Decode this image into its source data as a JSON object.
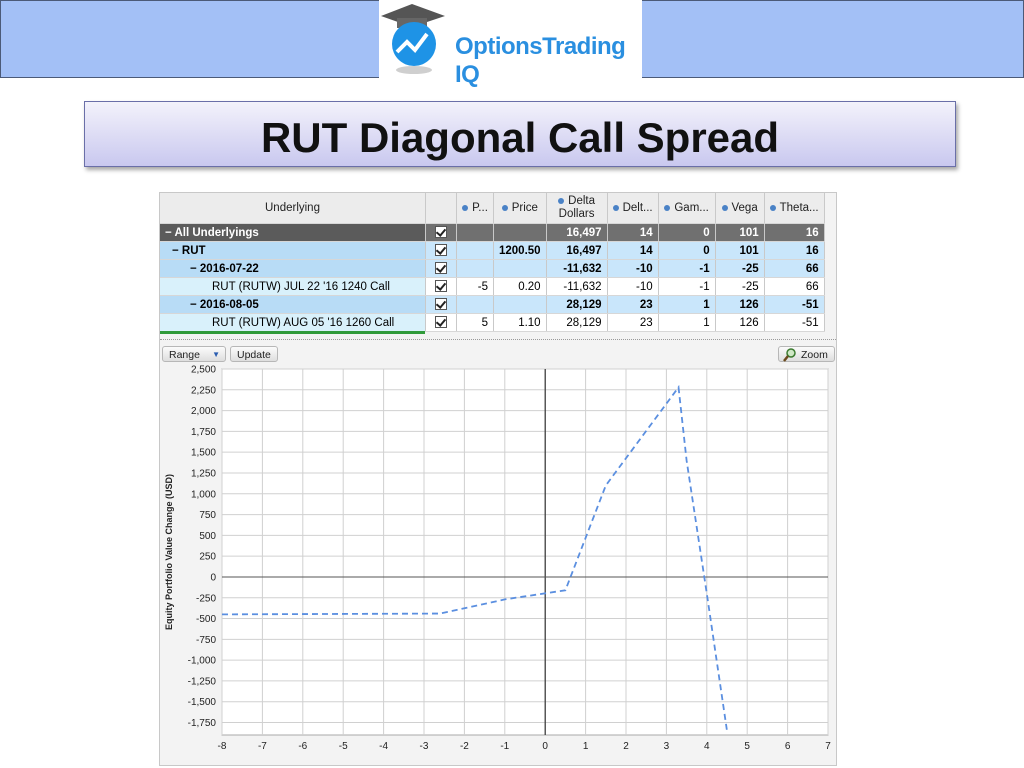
{
  "logo": {
    "brand_a": "Options",
    "brand_b": "Trading IQ"
  },
  "title": "RUT Diagonal Call Spread",
  "table": {
    "columns": [
      "Underlying",
      "",
      "P...",
      "Price",
      "Delta Dollars",
      "Delt...",
      "Gam...",
      "Vega",
      "Theta..."
    ],
    "rows": [
      {
        "type": "all",
        "label": "− All Underlyings",
        "p": "",
        "price": "",
        "dd": "16,497",
        "delta": "14",
        "gamma": "0",
        "vega": "101",
        "theta": "16"
      },
      {
        "type": "rut",
        "label": "− RUT",
        "p": "",
        "price": "1200.50",
        "dd": "16,497",
        "delta": "14",
        "gamma": "0",
        "vega": "101",
        "theta": "16"
      },
      {
        "type": "date",
        "label": "− 2016-07-22",
        "p": "",
        "price": "",
        "dd": "-11,632",
        "delta": "-10",
        "gamma": "-1",
        "vega": "-25",
        "theta": "66"
      },
      {
        "type": "pos",
        "label": "RUT (RUTW) JUL 22 '16 1240 Call",
        "p": "-5",
        "price": "0.20",
        "dd": "-11,632",
        "delta": "-10",
        "gamma": "-1",
        "vega": "-25",
        "theta": "66"
      },
      {
        "type": "date",
        "label": "− 2016-08-05",
        "p": "",
        "price": "",
        "dd": "28,129",
        "delta": "23",
        "gamma": "1",
        "vega": "126",
        "theta": "-51"
      },
      {
        "type": "pos",
        "label": "RUT (RUTW) AUG 05 '16 1260 Call",
        "p": "5",
        "price": "1.10",
        "dd": "28,129",
        "delta": "23",
        "gamma": "1",
        "vega": "126",
        "theta": "-51"
      }
    ]
  },
  "toolbar": {
    "range_label": "Range",
    "range_arrow": "▼",
    "update_label": "Update",
    "zoom_label": "Zoom"
  },
  "chart_data": {
    "type": "line",
    "ylabel": "Equity Portfolio Value Change (USD)",
    "xlim": [
      -8,
      7
    ],
    "ylim": [
      -1900,
      2500
    ],
    "x_ticks": [
      -8,
      -7,
      -6,
      -5,
      -4,
      -3,
      -2,
      -1,
      0,
      1,
      2,
      3,
      4,
      5,
      6,
      7
    ],
    "y_ticks": [
      2500,
      2250,
      2000,
      1750,
      1500,
      1250,
      1000,
      750,
      500,
      250,
      0,
      -250,
      -500,
      -750,
      -1000,
      -1250,
      -1500,
      -1750
    ],
    "y_tick_labels": [
      "2,500",
      "2,250",
      "2,000",
      "1,750",
      "1,500",
      "1,250",
      "1,000",
      "750",
      "500",
      "250",
      "0",
      "-250",
      "-500",
      "-750",
      "-1,000",
      "-1,250",
      "-1,500",
      "-1,750"
    ],
    "grid": true,
    "color": "#5b8fe0",
    "series": [
      {
        "x": [
          -8,
          -2.6,
          -1,
          0.5,
          1.5,
          3.3,
          3.5,
          4,
          4.5
        ],
        "y": [
          -450,
          -440,
          -270,
          -160,
          1100,
          2280,
          1400,
          -200,
          -1850
        ]
      }
    ]
  }
}
